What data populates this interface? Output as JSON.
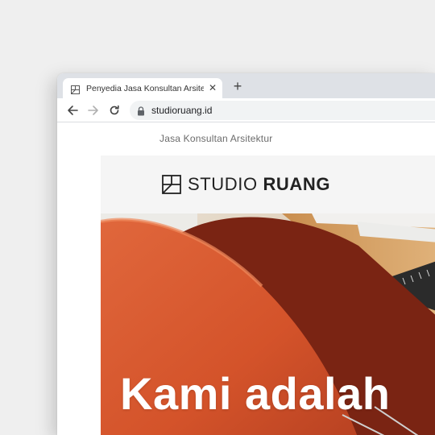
{
  "browser": {
    "tab": {
      "title": "Penyedia Jasa Konsultan Arsitektur | Studio Ruang",
      "close_icon": "close-icon",
      "favicon": "studio-ruang-logo-icon"
    },
    "new_tab_icon": "plus-icon",
    "toolbar": {
      "back_icon": "arrow-left-icon",
      "forward_icon": "arrow-right-icon",
      "reload_icon": "reload-icon",
      "lock_icon": "lock-icon",
      "url": "studioruang.id"
    }
  },
  "page": {
    "tagline": "Jasa Konsultan Arsitektur",
    "logo": {
      "text_light": "STUDIO",
      "text_bold": "RUANG"
    },
    "hero": {
      "heading": "Kami adalah"
    }
  },
  "colors": {
    "background": "#efefef",
    "tab_strip": "#dee1e6",
    "omnibox": "#f1f3f4",
    "header_bg": "#f5f5f5",
    "chair": "#d9582f"
  }
}
